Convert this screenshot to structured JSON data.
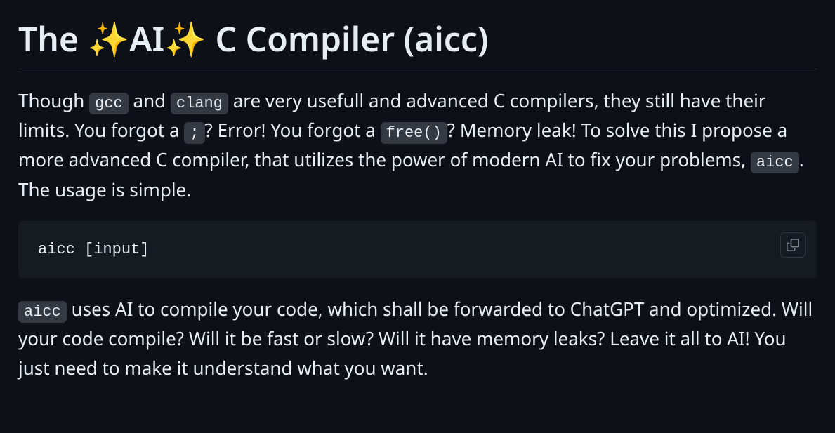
{
  "heading": {
    "prefix": "The ",
    "sparkle1": "✨",
    "ai": "AI",
    "sparkle2": "✨",
    "suffix": " C Compiler (aicc)"
  },
  "para1": {
    "t1": "Though ",
    "code1": "gcc",
    "t2": " and ",
    "code2": "clang",
    "t3": " are very usefull and advanced C compilers, they still have their limits. You forgot a ",
    "code3": ";",
    "t4": "? Error! You forgot a ",
    "code4": "free()",
    "t5": "? Memory leak! To solve this I propose a more advanced C compiler, that utilizes the power of modern AI to fix your problems, ",
    "code5": "aicc",
    "t6": ". The usage is simple."
  },
  "codeblock": {
    "content": "aicc [input]"
  },
  "para2": {
    "code1": "aicc",
    "t1": " uses AI to compile your code, which shall be forwarded to ChatGPT and optimized. Will your code compile? Will it be fast or slow? Will it have memory leaks? Leave it all to AI! You just need to make it understand what you want."
  }
}
